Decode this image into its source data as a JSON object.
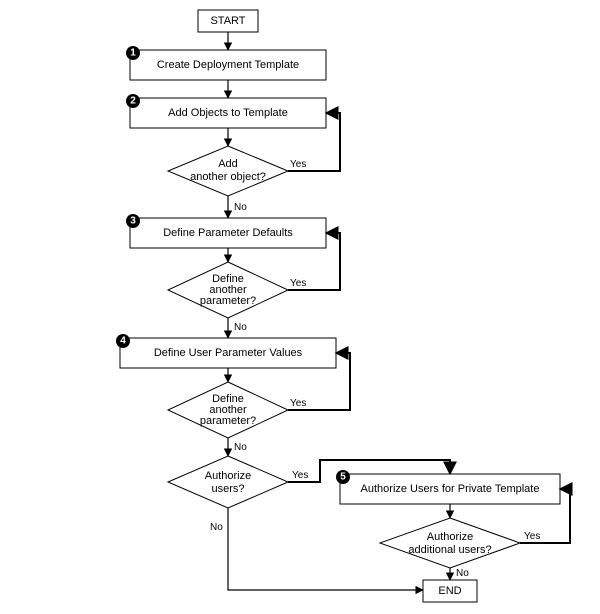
{
  "flow": {
    "start": "START",
    "end": "END",
    "steps": {
      "s1": {
        "num": "1",
        "label": "Create Deployment Template"
      },
      "s2": {
        "num": "2",
        "label": "Add Objects to Template"
      },
      "s3": {
        "num": "3",
        "label": "Define Parameter Defaults"
      },
      "s4": {
        "num": "4",
        "label": "Define User Parameter Values"
      },
      "s5": {
        "num": "5",
        "label": "Authorize Users for Private Template"
      }
    },
    "decisions": {
      "d1": {
        "l1": "Add",
        "l2": "another object?"
      },
      "d2": {
        "l1": "Define",
        "l2": "another",
        "l3": "parameter?"
      },
      "d3": {
        "l1": "Define",
        "l2": "another",
        "l3": "parameter?"
      },
      "d4": {
        "l1": "Authorize",
        "l2": "users?"
      },
      "d5": {
        "l1": "Authorize",
        "l2": "additional users?"
      }
    },
    "labels": {
      "yes": "Yes",
      "no": "No"
    }
  }
}
